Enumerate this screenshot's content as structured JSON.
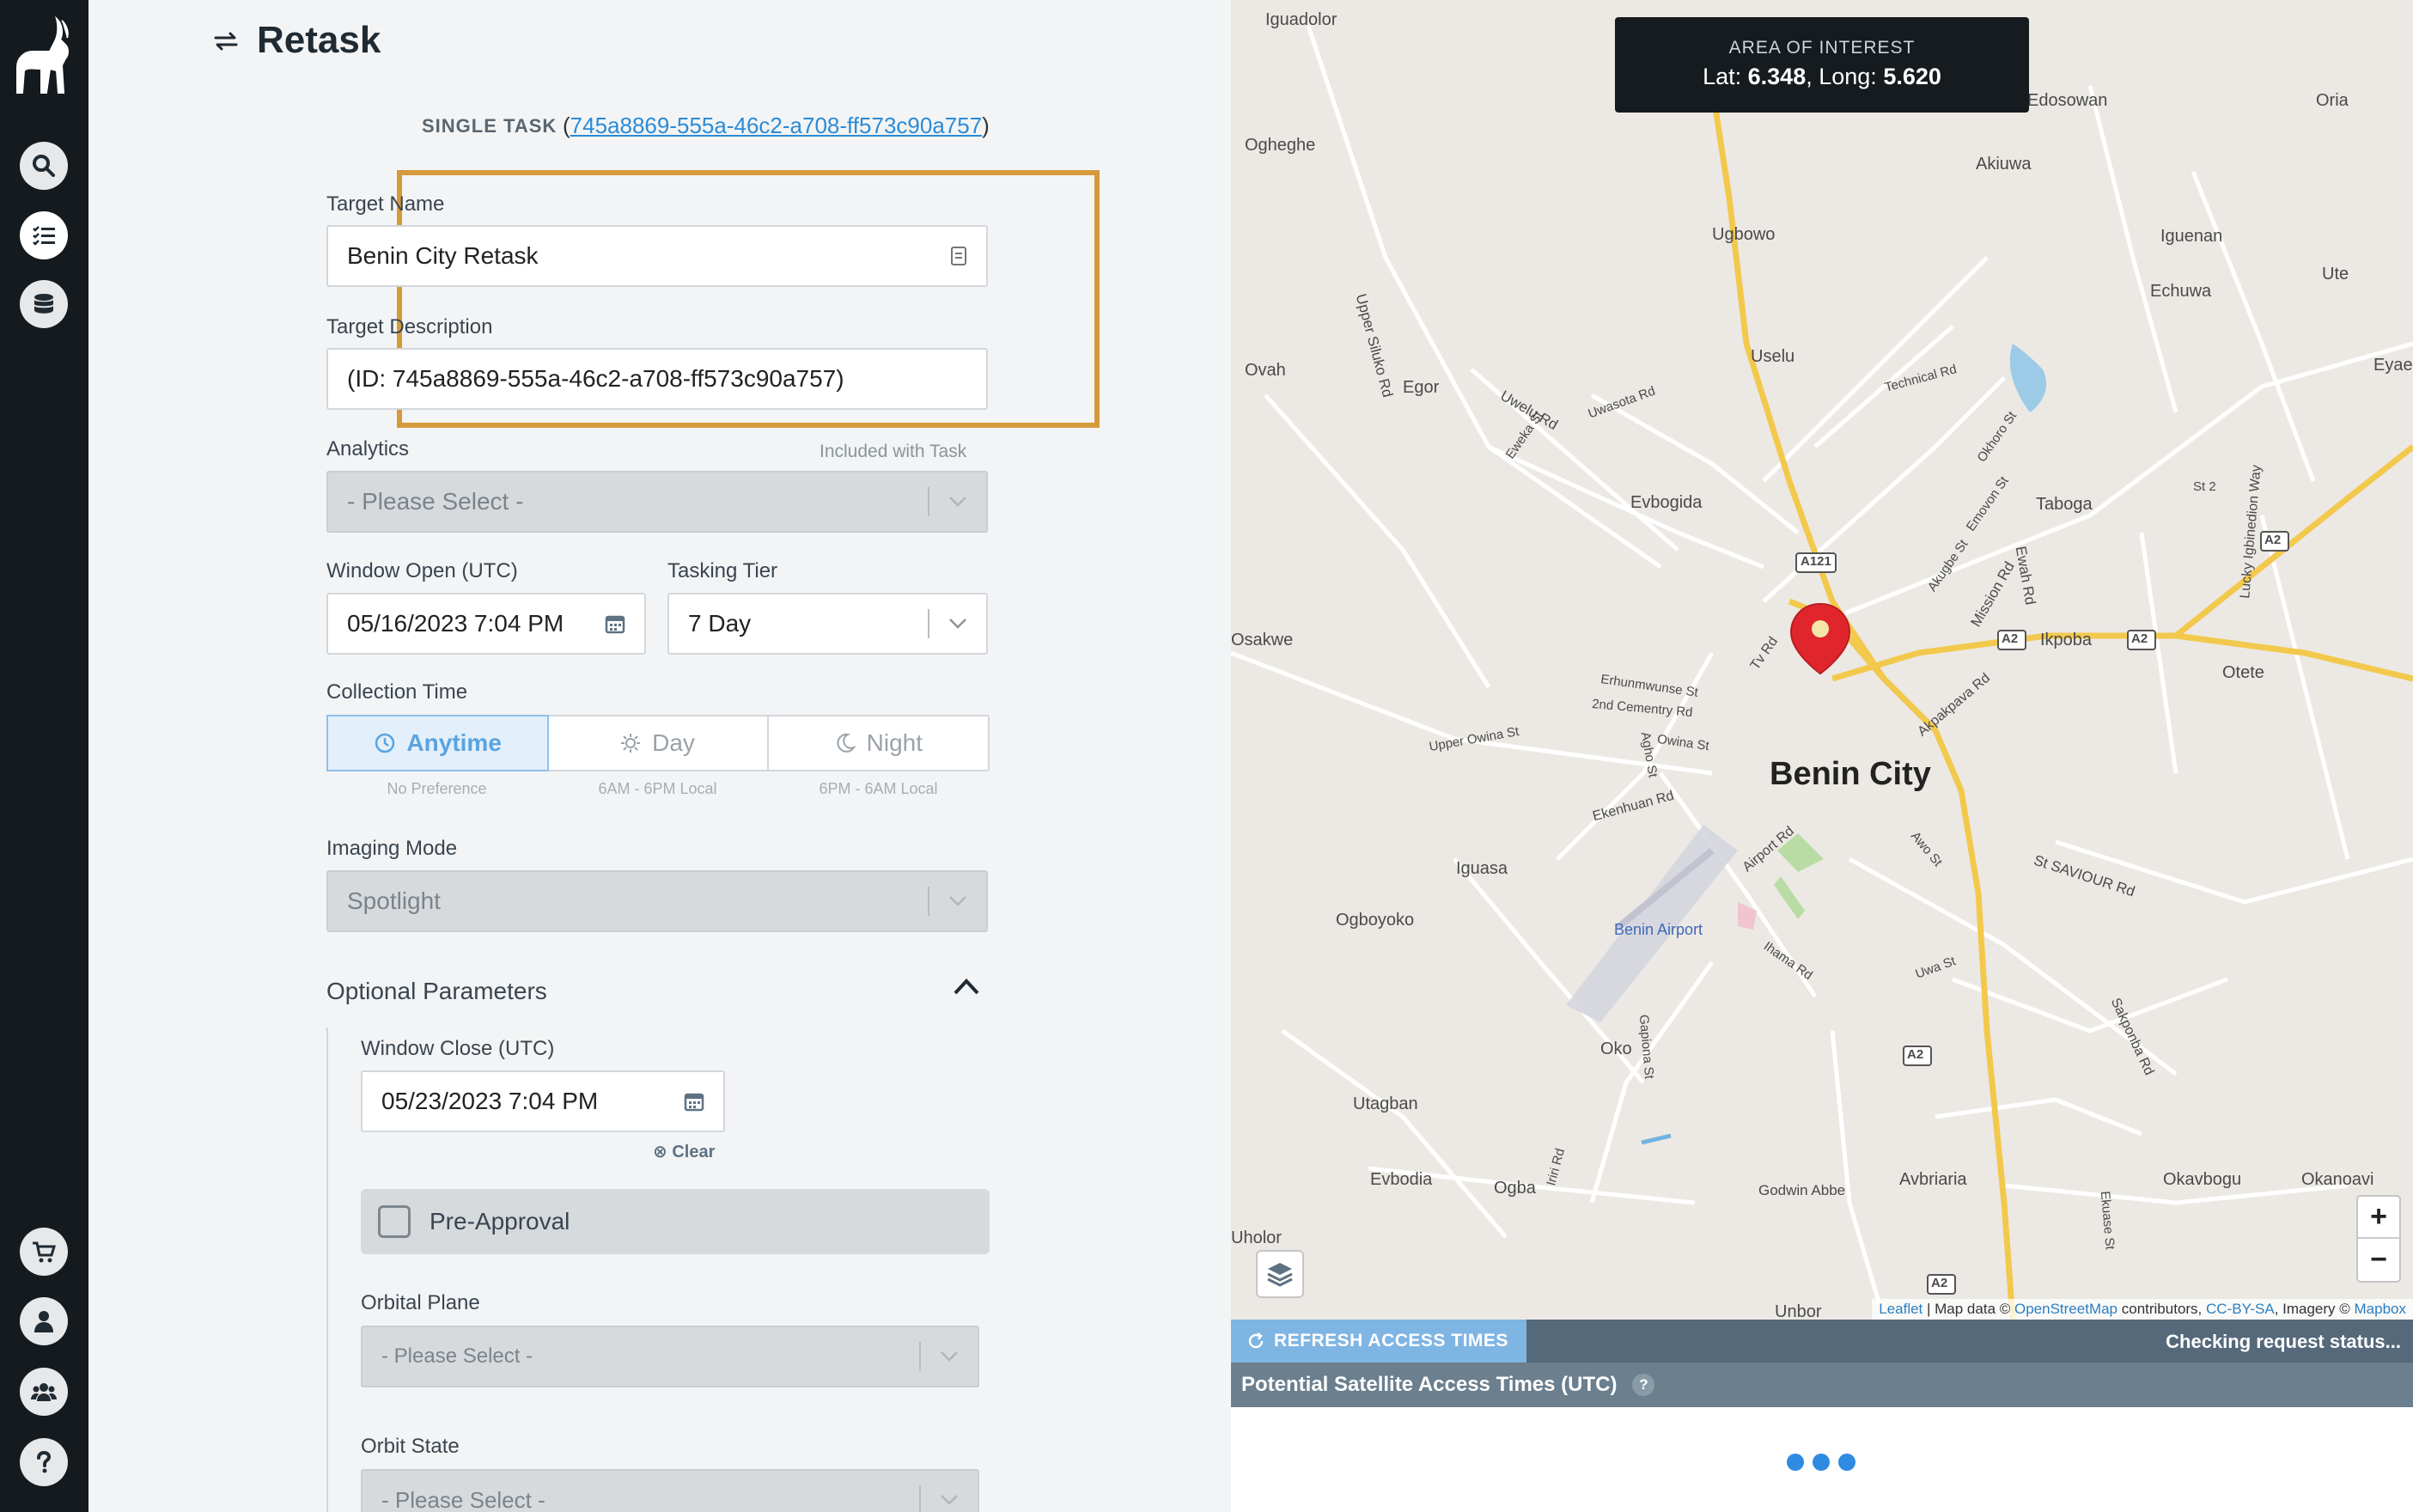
{
  "page": {
    "title": "Retask"
  },
  "sidebar": {
    "items": [
      "search-icon",
      "task-list-icon",
      "database-icon",
      "cart-icon",
      "user-icon",
      "team-icon",
      "help-icon"
    ]
  },
  "task": {
    "label": "SINGLE TASK",
    "id": "745a8869-555a-46c2-a708-ff573c90a757",
    "paren_open": "(",
    "paren_close": ")"
  },
  "form": {
    "target_name_label": "Target Name",
    "target_name_value": "Benin City Retask",
    "target_desc_label": "Target Description",
    "target_desc_value": "(ID: 745a8869-555a-46c2-a708-ff573c90a757)",
    "analytics_label": "Analytics",
    "analytics_note": "Included with Task",
    "analytics_value": "- Please Select -",
    "window_open_label": "Window Open (UTC)",
    "window_open_value": "05/16/2023 7:04 PM",
    "tier_label": "Tasking Tier",
    "tier_value": "7 Day",
    "collection_label": "Collection Time",
    "collection_options": [
      {
        "label": "Anytime",
        "sub": "No Preference"
      },
      {
        "label": "Day",
        "sub": "6AM - 6PM Local"
      },
      {
        "label": "Night",
        "sub": "6PM - 6AM Local"
      }
    ],
    "imaging_label": "Imaging Mode",
    "imaging_value": "Spotlight",
    "optional_title": "Optional Parameters",
    "window_close_label": "Window Close (UTC)",
    "window_close_value": "05/23/2023 7:04 PM",
    "clear_label": "Clear",
    "pre_approval_label": "Pre-Approval",
    "orbital_plane_label": "Orbital Plane",
    "orbital_plane_value": "- Please Select -",
    "orbit_state_label": "Orbit State",
    "orbit_state_value": "- Please Select -"
  },
  "map": {
    "aoi_label": "AREA OF INTEREST",
    "lat_label": "Lat:",
    "lat_value": "6.348",
    "long_label": "Long:",
    "long_value": "5.620",
    "zoom_in": "+",
    "zoom_out": "−",
    "places": [
      "Iguadolor",
      "Ogheghe",
      "Edosowan",
      "Oria",
      "Akiuwa",
      "Ugbowo",
      "Iguenan",
      "Echuwa",
      "Ute",
      "Ovah",
      "Egor",
      "Uselu",
      "Eyaen",
      "Evbogida",
      "Taboga",
      "Osakwe",
      "Ikpoba",
      "Otete",
      "Benin City",
      "Iguasa",
      "Ogboyoko",
      "Benin Airport",
      "Oko",
      "Utagban",
      "Evbodia",
      "Ogba",
      "Godwin Abbe",
      "Avbriaria",
      "Okavbogu",
      "Okanoavi",
      "Uholor",
      "Unbor"
    ],
    "roads": [
      "Upper Siluko Rd",
      "Uwelu Rd",
      "Uwasota Rd",
      "Technical Rd",
      "Okhoro St",
      "Emovon St",
      "Akugbe St",
      "Mission Rd",
      "Ewah Rd",
      "Lucky Igbinedion Way",
      "St 2",
      "Tv Rd",
      "Erhunmwunse St",
      "2nd Cementry Rd",
      "Owina St",
      "Upper Owina St",
      "Ekenhuan Rd",
      "Airport Rd",
      "Akpakpava Rd",
      "Awo St",
      "St SAVIOUR Rd",
      "Ihama Rd",
      "Uwa St",
      "Sakponba Rd",
      "Gapiona St",
      "Iriri Rd",
      "Ekuase St",
      "Eweka St",
      "Agho St"
    ],
    "shields": [
      "A121",
      "A2"
    ],
    "attribution": {
      "leaflet": "Leaflet",
      "sep": " | Map data © ",
      "osm": "OpenStreetMap",
      "contrib": " contributors, ",
      "license": "CC-BY-SA",
      "imagery": ", Imagery © ",
      "mapbox": "Mapbox"
    }
  },
  "access": {
    "refresh_label": "REFRESH ACCESS TIMES",
    "status": "Checking request status...",
    "header": "Potential Satellite Access Times (UTC)",
    "help": "?"
  },
  "colors": {
    "accent": "#2f8ae2",
    "highlight": "#d49a3c",
    "sidebar": "#141a1e",
    "marker": "#e0262c"
  }
}
